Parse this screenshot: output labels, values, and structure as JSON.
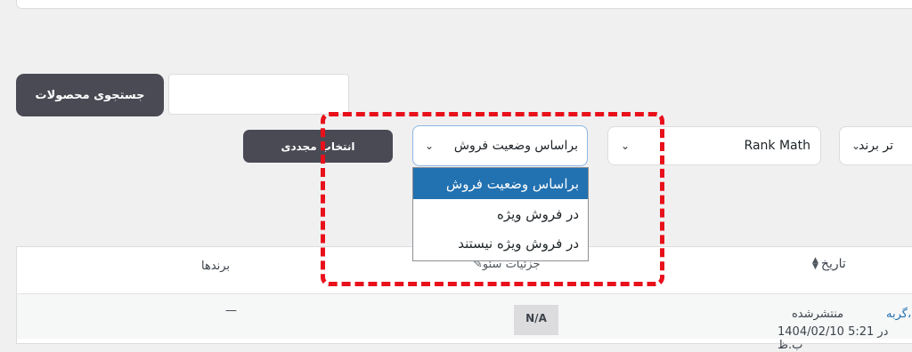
{
  "search": {
    "button_label": "جستجوی محصولات",
    "input_value": ""
  },
  "filters": {
    "reselect_label": "انتخاب مجددی",
    "sale_status": {
      "selected": "براساس وضعیت فروش",
      "options": [
        "براساس وضعیت فروش",
        "در فروش ویژه",
        "در فروش ویژه نیستند"
      ]
    },
    "seo_plugin": {
      "selected": "Rank Math"
    },
    "brand_filter": {
      "selected": "تر برند"
    }
  },
  "table": {
    "headers": {
      "date": "تاریخ",
      "seo_details": "جزئیات سئو",
      "brands": "برندها"
    },
    "rows": [
      {
        "status": "منتشرشده",
        "date": "1404/02/10 در 5:21 ب.ظ",
        "category": "گربه،",
        "seo": "N/A",
        "brands": "—"
      }
    ]
  },
  "highlight": {
    "color": "#e8101b"
  }
}
